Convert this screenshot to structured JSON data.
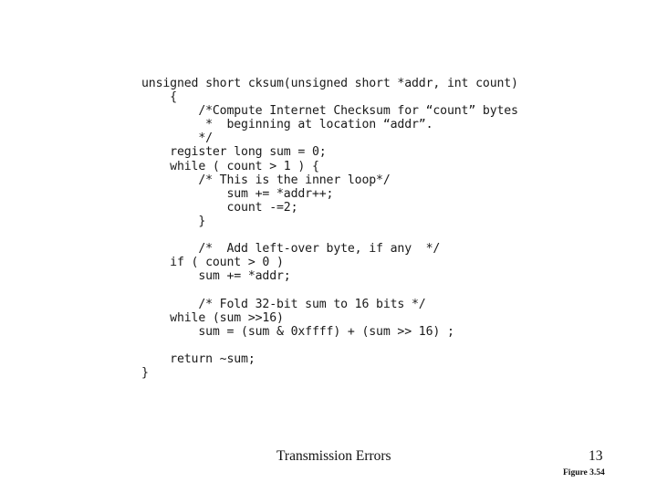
{
  "slide": {
    "background_color": "#ffffff",
    "text_color": "#000000"
  },
  "code_listing": {
    "language": "c",
    "name": "internet-checksum-function",
    "lines": [
      "unsigned short cksum(unsigned short *addr, int count)",
      "    {",
      "        /*Compute Internet Checksum for “count” bytes",
      "         *  beginning at location “addr”.",
      "        */",
      "    register long sum = 0;",
      "    while ( count > 1 ) {",
      "        /* This is the inner loop*/",
      "            sum += *addr++;",
      "            count -=2;",
      "        }",
      "",
      "        /*  Add left-over byte, if any  */",
      "    if ( count > 0 )",
      "        sum += *addr;",
      "",
      "        /* Fold 32-bit sum to 16 bits */",
      "    while (sum >>16)",
      "        sum = (sum & 0xffff) + (sum >> 16) ;",
      "",
      "    return ~sum;",
      "}"
    ]
  },
  "footer": {
    "title": "Transmission Errors",
    "page_number": "13",
    "figure_caption": "Figure 3.54"
  }
}
